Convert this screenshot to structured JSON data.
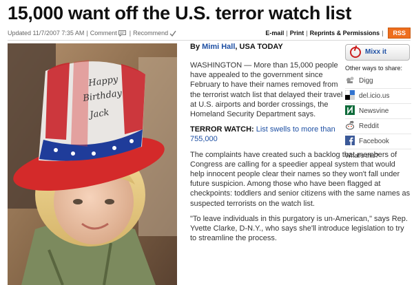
{
  "headline": "15,000 want off the U.S. terror watch list",
  "meta": {
    "updated": "Updated 11/7/2007 7:35 AM",
    "comment": "Comment",
    "recommend": "Recommend",
    "email": "E-mail",
    "print": "Print",
    "reprints": "Reprints & Permissions",
    "rss": "RSS"
  },
  "byline": {
    "prefix": "By",
    "author": "Mimi Hall",
    "outlet": ", USA TODAY"
  },
  "article": {
    "p1": "WASHINGTON — More than 15,000 people have appealed to the government since February to have their names removed from the terrorist watch list that delayed their travel at U.S. airports and border crossings, the Homeland Security Department says.",
    "terror_label": "TERROR WATCH:",
    "terror_link": "List swells to more than 755,000",
    "p2": "The complaints have created such a backlog that members of Congress are calling for a speedier appeal system that would help innocent people clear their names so they won't fall under future suspicion. Among those who have been flagged at checkpoints: toddlers and senior citizens with the same names as suspected terrorists on the watch list.",
    "p3": "\"To leave individuals in this purgatory is un-American,\" says Rep. Yvette Clarke, D-N.Y., who says she'll introduce legislation to try to streamline the process."
  },
  "photo": {
    "hat_text_1": "Happy",
    "hat_text_2": "Birthday",
    "hat_text_3": "Jack"
  },
  "share": {
    "mixx": "Mixx it",
    "other_ways": "Other ways to share:",
    "items": [
      {
        "label": "Digg",
        "icon": "digg-icon"
      },
      {
        "label": "del.icio.us",
        "icon": "delicious-icon"
      },
      {
        "label": "Newsvine",
        "icon": "newsvine-icon"
      },
      {
        "label": "Reddit",
        "icon": "reddit-icon"
      },
      {
        "label": "Facebook",
        "icon": "facebook-icon"
      }
    ],
    "whats_this": "What's this?"
  },
  "colors": {
    "link": "#1d4fa3",
    "rss": "#ee6e1e",
    "hat_red": "#d42a2a"
  }
}
